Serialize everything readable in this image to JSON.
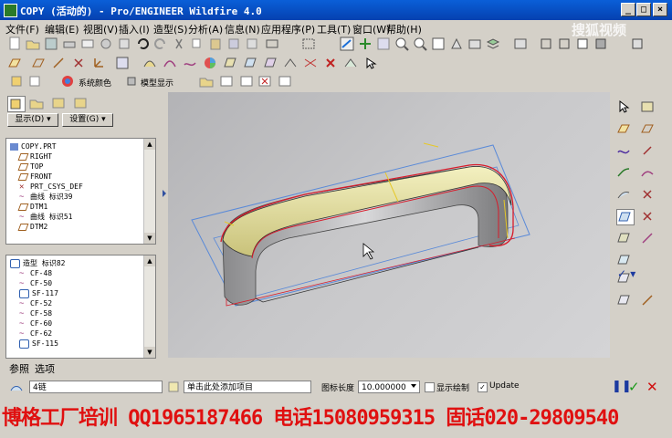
{
  "window": {
    "title": "COPY (活动的) - Pro/ENGINEER Wildfire 4.0"
  },
  "watermark": "搜狐视频",
  "menu": [
    "文件(F)",
    "编辑(E)",
    "视图(V)",
    "插入(I)",
    "造型(S)",
    "分析(A)",
    "信息(N)",
    "应用程序(P)",
    "工具(T)",
    "窗口(W)",
    "帮助(H)"
  ],
  "toolbar3": {
    "system_color": "系统颜色",
    "model_display": "模型显示"
  },
  "left_panel": {
    "display_button": "显示(D) ▾",
    "settings_button": "设置(G) ▾",
    "model_tree": [
      {
        "label": "COPY.PRT",
        "icon": "part-icon"
      },
      {
        "label": "RIGHT",
        "icon": "datum-plane-icon"
      },
      {
        "label": "TOP",
        "icon": "datum-plane-icon"
      },
      {
        "label": "FRONT",
        "icon": "datum-plane-icon"
      },
      {
        "label": "PRT_CSYS_DEF",
        "icon": "csys-icon"
      },
      {
        "label": "曲线 标识39",
        "icon": "curve-icon"
      },
      {
        "label": "DTM1",
        "icon": "datum-plane-icon"
      },
      {
        "label": "曲线 标识51",
        "icon": "curve-icon"
      },
      {
        "label": "DTM2",
        "icon": "datum-plane-icon"
      }
    ],
    "style_tree": [
      {
        "label": "造型 标识82",
        "icon": "style-icon"
      },
      {
        "label": "CF-48",
        "icon": "style-curve-icon"
      },
      {
        "label": "CF-50",
        "icon": "style-curve-icon"
      },
      {
        "label": "SF-117",
        "icon": "style-surface-icon"
      },
      {
        "label": "CF-52",
        "icon": "style-curve-icon"
      },
      {
        "label": "CF-58",
        "icon": "style-curve-icon"
      },
      {
        "label": "CF-60",
        "icon": "style-curve-icon"
      },
      {
        "label": "CF-62",
        "icon": "style-curve-icon"
      },
      {
        "label": "SF-115",
        "icon": "style-surface-icon"
      }
    ]
  },
  "tabs": {
    "references": "参照",
    "options": "选项"
  },
  "dashboard": {
    "chain_count": "4链",
    "add_item_hint": "单击此处添加项目",
    "icon_length_label": "图标长度",
    "icon_length_value": "10.000000",
    "show_draw_label": "显示绘制",
    "show_draw_checked": false,
    "update_label": "Update",
    "update_checked": true
  },
  "banner": "博格工厂培训 QQ1965187466 电话15080959315 固话020-29809540",
  "colors": {
    "titlebar": "#0541b0",
    "surface": "#e7e7a2",
    "edge": "#d81b2a",
    "plane": "#5a8ad8",
    "banner_text": "#e01010"
  }
}
